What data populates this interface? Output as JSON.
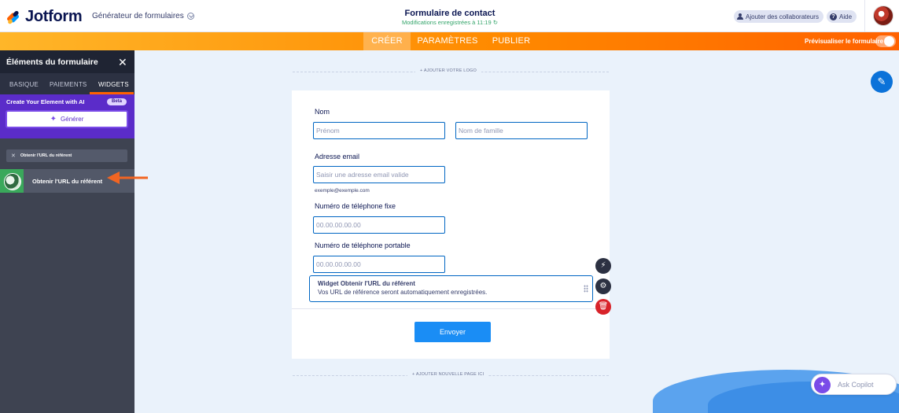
{
  "header": {
    "brand": "Jotform",
    "builder_select": "Générateur de formulaires",
    "form_title": "Formulaire de contact",
    "save_status": "Modifications enregistrées à 11:19",
    "add_collaborators": "Ajouter des collaborateurs",
    "help": "Aide"
  },
  "nav": {
    "tabs": [
      {
        "label": "CRÉER",
        "active": true
      },
      {
        "label": "PARAMÈTRES",
        "active": false
      },
      {
        "label": "PUBLIER",
        "active": false
      }
    ],
    "preview_label": "Prévisualiser le formulaire"
  },
  "panel": {
    "title": "Éléments du formulaire",
    "tabs": [
      "BASIQUE",
      "PAIEMENTS",
      "WIDGETS"
    ],
    "active_tab": "WIDGETS",
    "ai_title": "Create Your Element with AI",
    "beta_badge": "Beta",
    "generate_button": "Générer",
    "search_filter": "Obtenir l'URL du référent",
    "widget_item": "Obtenir l'URL du référent"
  },
  "form": {
    "add_logo": "+ AJOUTER VOTRE LOGO",
    "name_label": "Nom",
    "first_name_placeholder": "Prénom",
    "last_name_placeholder": "Nom de famille",
    "email_label": "Adresse email",
    "email_placeholder": "Saisir une adresse email valide",
    "email_example": "exemple@exemple.com",
    "phone_label": "Numéro de téléphone fixe",
    "phone_placeholder": "00.00.00.00.00",
    "mobile_label": "Numéro de téléphone portable",
    "mobile_placeholder": "00.00.00.00.00",
    "widget_title": "Widget Obtenir l'URL du référent",
    "widget_desc": "Vos URL de référence seront automatiquement enregistrées.",
    "submit": "Envoyer",
    "add_page": "+ AJOUTER NOUVELLE PAGE ICI"
  },
  "copilot": {
    "label": "Ask Copilot"
  },
  "colors": {
    "accent_orange": "#ff6100",
    "accent_blue": "#0066c3",
    "ai_purple": "#5b2cc9",
    "delete_red": "#d8232a"
  }
}
